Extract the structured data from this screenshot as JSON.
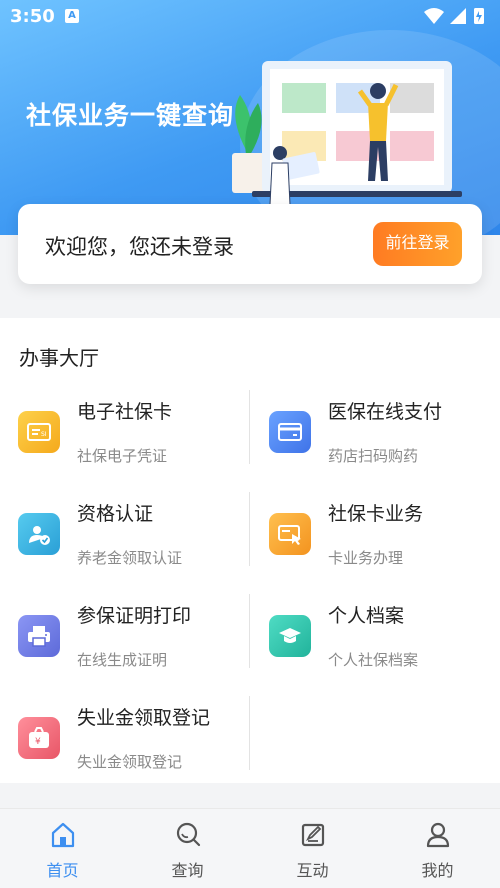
{
  "status_bar": {
    "time": "3:50",
    "badge": "A"
  },
  "hero": {
    "title": "社保业务一键查询"
  },
  "login_card": {
    "message": "欢迎您，您还未登录",
    "button_label": "前往登录"
  },
  "hall": {
    "title": "办事大厅",
    "services": [
      {
        "title": "电子社保卡",
        "subtitle": "社保电子凭证",
        "icon": "social-card-icon",
        "color": "#f7b829"
      },
      {
        "title": "医保在线支付",
        "subtitle": "药店扫码购药",
        "icon": "payment-card-icon",
        "color": "#4f86ee"
      },
      {
        "title": "资格认证",
        "subtitle": "养老金领取认证",
        "icon": "user-verify-icon",
        "color": "#35b3df"
      },
      {
        "title": "社保卡业务",
        "subtitle": "卡业务办理",
        "icon": "card-touch-icon",
        "color": "#f5a93a"
      },
      {
        "title": "参保证明打印",
        "subtitle": "在线生成证明",
        "icon": "printer-icon",
        "color": "#6f7de8"
      },
      {
        "title": "个人档案",
        "subtitle": "个人社保档案",
        "icon": "graduation-cap-icon",
        "color": "#34c9b0"
      },
      {
        "title": "失业金领取登记",
        "subtitle": "失业金领取登记",
        "icon": "money-bag-icon",
        "color": "#f06f7e"
      }
    ]
  },
  "tabbar": {
    "tabs": [
      {
        "label": "首页",
        "icon": "home-icon",
        "active": true
      },
      {
        "label": "查询",
        "icon": "search-icon",
        "active": false
      },
      {
        "label": "互动",
        "icon": "edit-icon",
        "active": false
      },
      {
        "label": "我的",
        "icon": "user-icon",
        "active": false
      }
    ]
  },
  "colors": {
    "primary": "#3d8ff0",
    "login_button": "#ff8c26"
  }
}
